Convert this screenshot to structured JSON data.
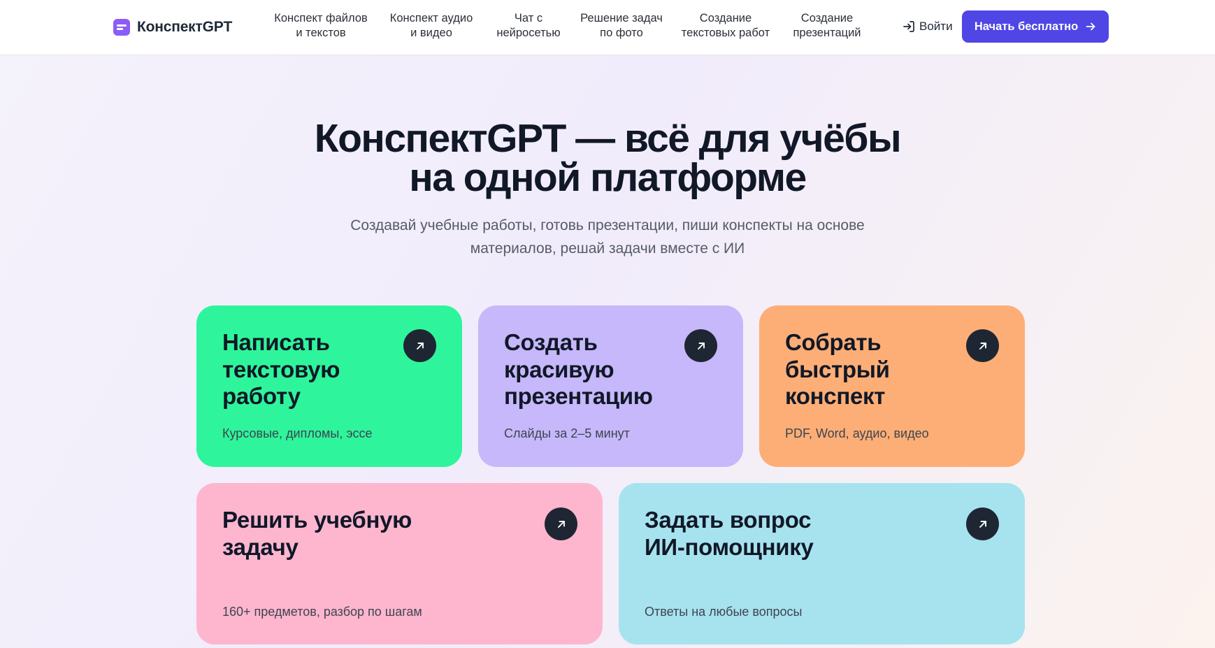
{
  "header": {
    "logo_text": "КонспектGPT",
    "nav": [
      {
        "line1": "Конспект файлов",
        "line2": "и текстов"
      },
      {
        "line1": "Конспект аудио",
        "line2": "и видео"
      },
      {
        "line1": "Чат с",
        "line2": "нейросетью"
      },
      {
        "line1": "Решение задач",
        "line2": "по фото"
      },
      {
        "line1": "Создание",
        "line2": "текстовых работ"
      },
      {
        "line1": "Создание",
        "line2": "презентаций"
      }
    ],
    "login_label": "Войти",
    "cta_label": "Начать бесплатно"
  },
  "hero": {
    "title_line1": "КонспектGPT — всё для учёбы",
    "title_line2": "на одной платформе",
    "subtitle_line1": "Создавай учебные работы, готовь презентации, пиши конспекты на основе",
    "subtitle_line2": "материалов, решай задачи вместе с ИИ"
  },
  "cards": [
    {
      "title": [
        "Написать",
        "текстовую",
        "работу"
      ],
      "subtitle": "Курсовые, дипломы, эссе",
      "color": "#2ef59b"
    },
    {
      "title": [
        "Создать",
        "красивую",
        "презентацию"
      ],
      "subtitle": "Слайды за 2–5 минут",
      "color": "#c6b8fb"
    },
    {
      "title": [
        "Собрать",
        "быстрый",
        "конспект"
      ],
      "subtitle": "PDF, Word, аудио, видео",
      "color": "#fdae76"
    },
    {
      "title": [
        "Решить учебную",
        "задачу"
      ],
      "subtitle": "160+ предметов, разбор по шагам",
      "color": "#feb6cf"
    },
    {
      "title": [
        "Задать вопрос",
        "ИИ-помощнику"
      ],
      "subtitle": "Ответы на любые вопросы",
      "color": "#a7e3ef"
    }
  ],
  "icons": {
    "card_arrow": "arrow-up-right-icon",
    "login": "login-icon",
    "cta": "arrow-right-icon",
    "logo": "logo-icon"
  }
}
